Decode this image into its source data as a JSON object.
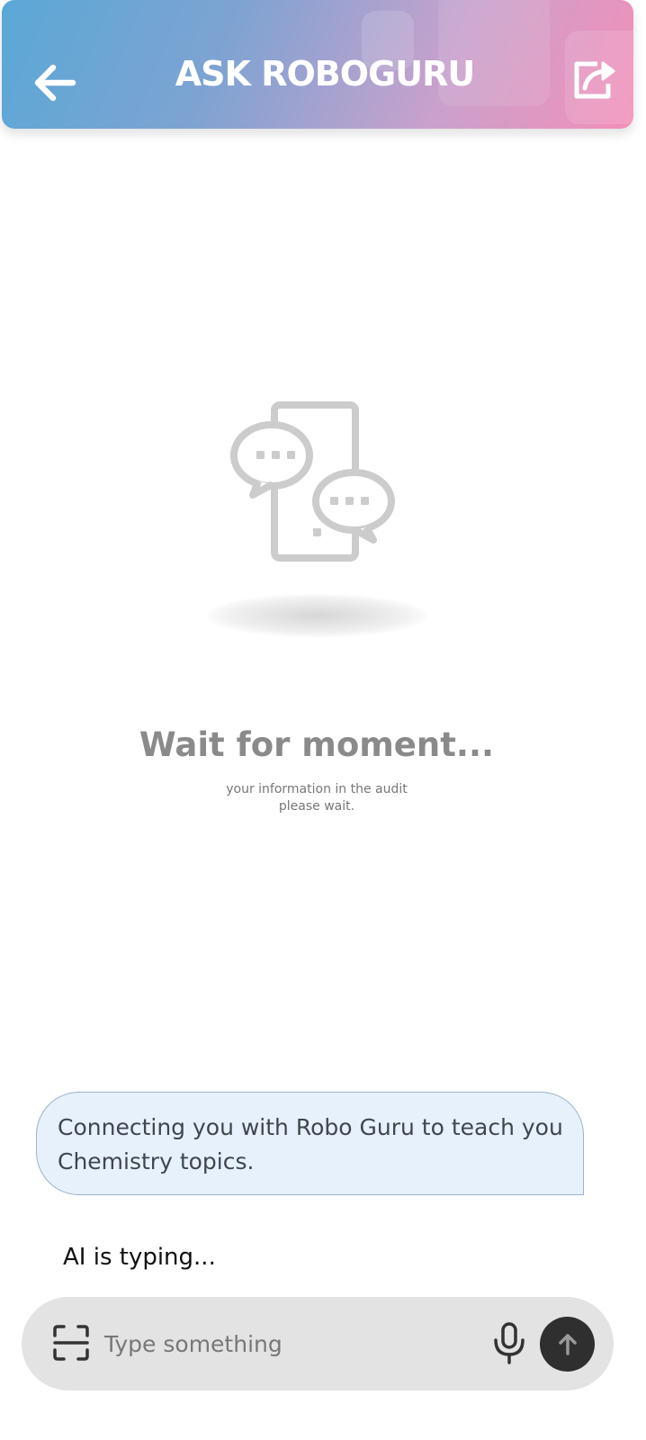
{
  "header": {
    "title": "ASK ROBOGURU",
    "back_icon": "arrow-left-icon",
    "share_icon": "share-icon",
    "gradient_colors": [
      "#5aa8d6",
      "#f38fb8"
    ]
  },
  "loader": {
    "illustration_icon": "phone-chat-bubbles-icon",
    "title": "Wait for moment...",
    "subtitle_line1": "your information in the audit",
    "subtitle_line2": "please wait."
  },
  "chat": {
    "bot_message": "Connecting you with Robo Guru to teach you Chemistry topics.",
    "bubble_color": "#e6f1fb",
    "typing_status": "AI is typing..."
  },
  "composer": {
    "placeholder": "Type something",
    "value": "",
    "scan_icon": "scan-icon",
    "mic_icon": "microphone-icon",
    "send_icon": "arrow-up-icon",
    "send_color": "#2f2f2f"
  }
}
